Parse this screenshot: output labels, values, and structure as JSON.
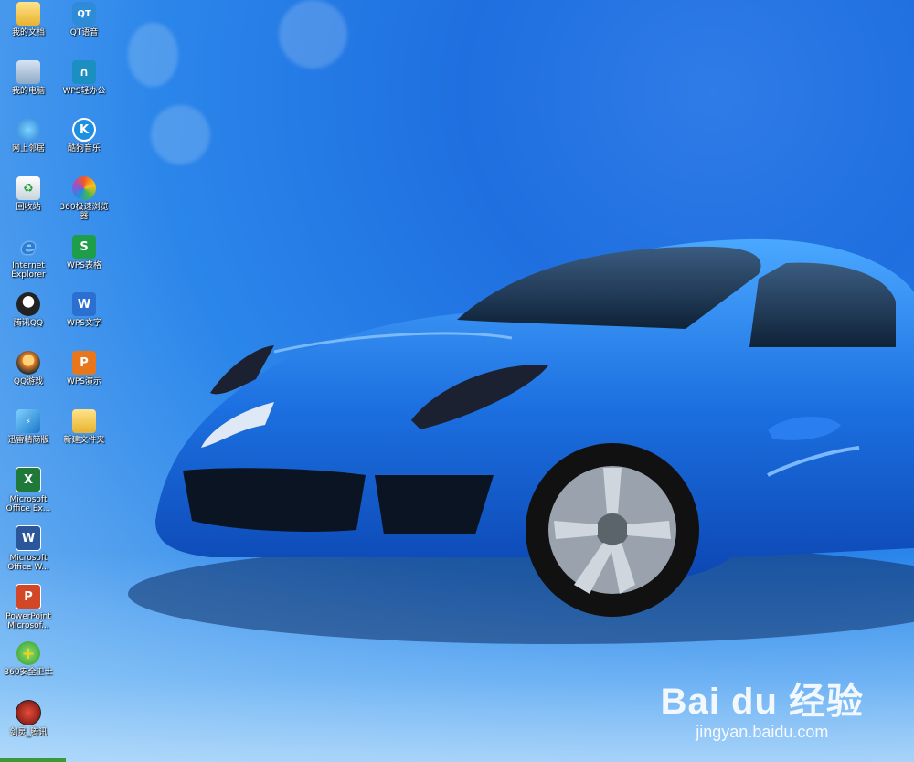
{
  "desktop": {
    "icons": [
      {
        "label": "我的文档",
        "icon": "folder-documents-icon",
        "color": "#f2c94c"
      },
      {
        "label": "QT语音",
        "icon": "qt-voice-icon",
        "color": "#2e8bd8"
      },
      {
        "label": "我的电脑",
        "icon": "my-computer-icon",
        "color": "#9ab6d6"
      },
      {
        "label": "WPS轻办公",
        "icon": "wps-light-office-icon",
        "color": "#1aa0c8"
      },
      {
        "label": "网上邻居",
        "icon": "network-icon",
        "color": "#4aa3df"
      },
      {
        "label": "酷狗音乐",
        "icon": "kugou-music-icon",
        "color": "#1d8fe1"
      },
      {
        "label": "回收站",
        "icon": "recycle-bin-icon",
        "color": "#dfe8ef"
      },
      {
        "label": "360极速浏览\n器",
        "icon": "360-browser-icon",
        "color": "#f05a28"
      },
      {
        "label": "Internet\nExplorer",
        "icon": "ie-icon",
        "color": "#2a7fd4"
      },
      {
        "label": "WPS表格",
        "icon": "wps-spreadsheet-icon",
        "color": "#1e9e48"
      },
      {
        "label": "腾讯QQ",
        "icon": "qq-icon",
        "color": "#222222"
      },
      {
        "label": "WPS文字",
        "icon": "wps-writer-icon",
        "color": "#2b6fd1"
      },
      {
        "label": "QQ游戏",
        "icon": "qq-game-icon",
        "color": "#f39c12"
      },
      {
        "label": "WPS演示",
        "icon": "wps-presentation-icon",
        "color": "#e8761a"
      },
      {
        "label": "迅雷精简版",
        "icon": "thunder-lite-icon",
        "color": "#3aa0e0"
      },
      {
        "label": "新建文件夹",
        "icon": "new-folder-icon",
        "color": "#f2c94c"
      },
      {
        "label": "Microsoft\nOffice Ex...",
        "icon": "excel-icon",
        "color": "#1f7a3a"
      },
      {
        "label": "Microsoft\nOffice W...",
        "icon": "word-icon",
        "color": "#2b579a"
      },
      {
        "label": "PowerPoint\nMicrosof...",
        "icon": "powerpoint-icon",
        "color": "#d24726"
      },
      {
        "label": "360安全卫士",
        "icon": "360-safe-icon",
        "color": "#4cb848"
      },
      {
        "label": "剑灵_腾讯",
        "icon": "blade-soul-icon",
        "color": "#c0392b"
      }
    ]
  },
  "glyphs": {
    "qt": "QT",
    "wps_light": "∩",
    "kugou": "K",
    "wps_s": "S",
    "wps_w": "W",
    "wps_p": "P",
    "excel": "X",
    "word": "W",
    "ppt": "P",
    "safe": "+",
    "ie": "e"
  },
  "watermark": {
    "brand": "Bai du 经验",
    "url": "jingyan.baidu.com"
  }
}
